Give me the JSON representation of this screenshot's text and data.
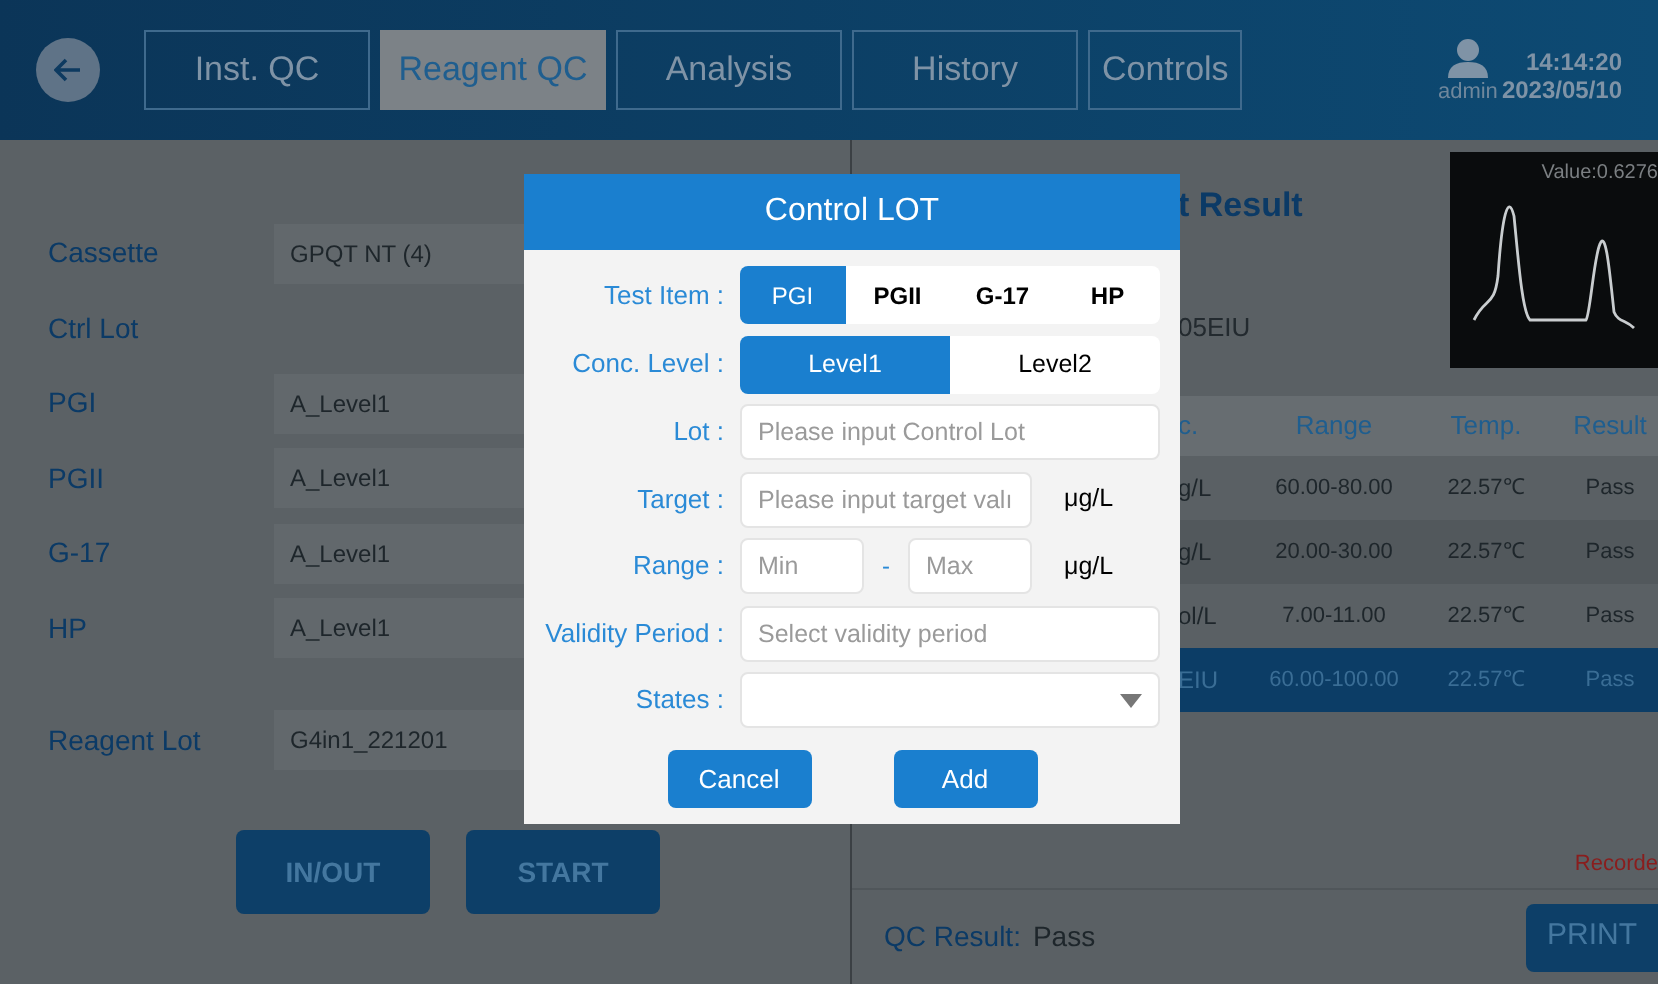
{
  "nav": {
    "tabs": [
      {
        "label": "Inst. QC",
        "selected": false
      },
      {
        "label": "Reagent QC",
        "selected": true
      },
      {
        "label": "Analysis",
        "selected": false
      },
      {
        "label": "History",
        "selected": false
      },
      {
        "label": "Controls",
        "selected": false
      }
    ],
    "user": "admin",
    "time": "14:14:20",
    "date": "2023/05/10"
  },
  "left": {
    "fields": [
      {
        "label": "Cassette",
        "value": "GPQT NT (4)"
      },
      {
        "label": "Ctrl Lot"
      },
      {
        "label": "PGI",
        "value": "A_Level1"
      },
      {
        "label": "PGII",
        "value": "A_Level1"
      },
      {
        "label": "G-17",
        "value": "A_Level1"
      },
      {
        "label": "HP",
        "value": "A_Level1"
      }
    ],
    "reagent_lot": {
      "label": "Reagent Lot",
      "value": "G4in1_221201"
    },
    "buttons": [
      "IN/OUT",
      "START"
    ]
  },
  "right": {
    "title": "t Result",
    "sample": "05EIU",
    "chart_value": "Value:0.6276",
    "columns": [
      "c.",
      "Range",
      "Temp.",
      "Result"
    ],
    "rows": [
      {
        "cells": [
          "g/L",
          "60.00-80.00",
          "22.57℃",
          "Pass"
        ],
        "selected": false
      },
      {
        "cells": [
          "g/L",
          "20.00-30.00",
          "22.57℃",
          "Pass"
        ],
        "selected": false
      },
      {
        "cells": [
          "ol/L",
          "7.00-11.00",
          "22.57℃",
          "Pass"
        ],
        "selected": false
      },
      {
        "cells": [
          "EIU",
          "60.00-100.00",
          "22.57℃",
          "Pass"
        ],
        "selected": true
      }
    ],
    "note": "Recorde",
    "qc_label": "QC Result:",
    "qc_value": "Pass",
    "print": "PRINT"
  },
  "dialog": {
    "title": "Control LOT",
    "test_item": {
      "label": "Test Item :",
      "options": [
        {
          "label": "PGI",
          "selected": true
        },
        {
          "label": "PGII",
          "selected": false
        },
        {
          "label": "G-17",
          "selected": false
        },
        {
          "label": "HP",
          "selected": false
        }
      ]
    },
    "level": {
      "label": "Conc. Level :",
      "options": [
        {
          "label": "Level1",
          "selected": true
        },
        {
          "label": "Level2",
          "selected": false
        }
      ]
    },
    "lot": {
      "label": "Lot :",
      "placeholder": "Please input Control Lot"
    },
    "target": {
      "label": "Target :",
      "placeholder": "Please input target valı",
      "unit": "μg/L"
    },
    "range": {
      "label": "Range :",
      "min_placeholder": "Min",
      "dash": "-",
      "max_placeholder": "Max",
      "unit": "μg/L"
    },
    "validity": {
      "label": "Validity Period :",
      "placeholder": "Select validity period"
    },
    "states": {
      "label": "States :"
    },
    "buttons": [
      "Cancel",
      "Add"
    ]
  }
}
